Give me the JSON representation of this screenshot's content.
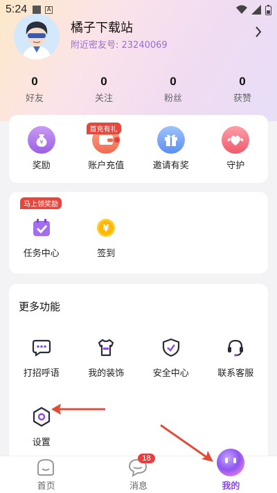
{
  "status_bar": {
    "time": "5:24"
  },
  "profile": {
    "username": "橘子下载站",
    "id_label": "附近密友号: 23240069"
  },
  "stats": [
    {
      "value": "0",
      "label": "好友"
    },
    {
      "value": "0",
      "label": "关注"
    },
    {
      "value": "0",
      "label": "粉丝"
    },
    {
      "value": "0",
      "label": "获赞"
    }
  ],
  "quick_actions": {
    "items": [
      {
        "label": "奖励",
        "icon": "money-bag-icon"
      },
      {
        "label": "账户充值",
        "icon": "wallet-icon",
        "tag": "首充有礼"
      },
      {
        "label": "邀请有奖",
        "icon": "gift-icon"
      },
      {
        "label": "守护",
        "icon": "heart-wings-icon"
      }
    ]
  },
  "tasks": {
    "tag": "马上领奖励",
    "items": [
      {
        "label": "任务中心",
        "icon": "calendar-check-icon"
      },
      {
        "label": "签到",
        "icon": "coin-icon"
      }
    ]
  },
  "more": {
    "title": "更多功能",
    "items": [
      {
        "label": "打招呼语",
        "icon": "chat-bubble-icon"
      },
      {
        "label": "我的装饰",
        "icon": "shirt-icon"
      },
      {
        "label": "安全中心",
        "icon": "shield-icon"
      },
      {
        "label": "联系客服",
        "icon": "headset-icon"
      },
      {
        "label": "设置",
        "icon": "gear-icon"
      }
    ]
  },
  "tabbar": {
    "tabs": [
      {
        "label": "首页"
      },
      {
        "label": "消息",
        "badge": "18"
      },
      {
        "label": "我的"
      }
    ]
  },
  "colors": {
    "accent": "#8c4be0",
    "tag_red": "#e8453c",
    "annotation_arrow": "#e24c37"
  }
}
